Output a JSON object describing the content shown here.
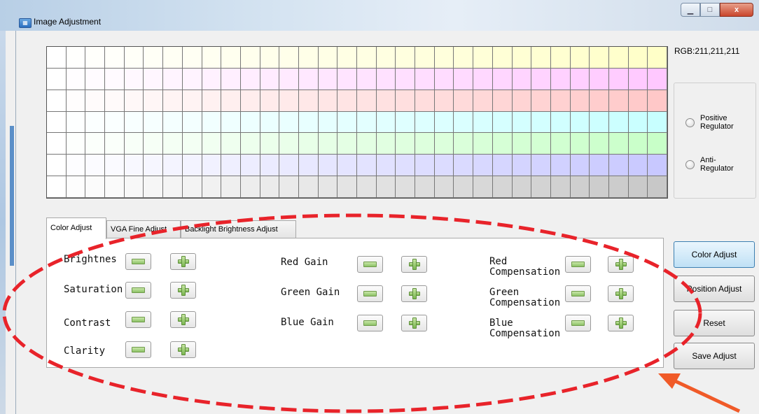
{
  "window": {
    "title": "Image Adjustment",
    "controls": {
      "minimize": "minimize-icon",
      "maximize": "maximize-icon",
      "close": "close-icon"
    },
    "close_symbol": "x"
  },
  "color_grid": {
    "columns": 32,
    "row_colors": [
      "#ffffc8",
      "#ffc8ff",
      "#ffc8c8",
      "#c8ffff",
      "#c8ffc8",
      "#c8c8ff",
      "#c8c8c8"
    ],
    "start_color": "#ffffff"
  },
  "rgb_readout": "RGB:211,211,211",
  "regulator": {
    "options": [
      {
        "label": "Positive Regulator",
        "selected": false
      },
      {
        "label": "Anti-Regulator",
        "selected": false
      }
    ]
  },
  "tabs": [
    {
      "label": "Color Adjust",
      "active": true
    },
    {
      "label": "VGA Fine Adjust",
      "active": false
    },
    {
      "label": "Backlight Brightness Adjust",
      "active": false
    }
  ],
  "color_adjust": {
    "col1": [
      {
        "label": "Brightnes"
      },
      {
        "label": "Saturation"
      },
      {
        "label": "Contrast"
      },
      {
        "label": "Clarity"
      }
    ],
    "col2": [
      {
        "label": "Red Gain"
      },
      {
        "label": "Green Gain"
      },
      {
        "label": "Blue Gain"
      }
    ],
    "col3": [
      {
        "label": "Red Compensation"
      },
      {
        "label": "Green Compensation"
      },
      {
        "label": "Blue Compensation"
      }
    ],
    "decrease_icon": "minus-icon",
    "increase_icon": "plus-icon"
  },
  "side_buttons": [
    {
      "label": "Color Adjust"
    },
    {
      "label": "Position Adjust"
    },
    {
      "label": "Reset"
    },
    {
      "label": "Save Adjust"
    }
  ],
  "annotation": {
    "ellipse_color": "#e8232a",
    "arrow_color": "#f05a28"
  }
}
